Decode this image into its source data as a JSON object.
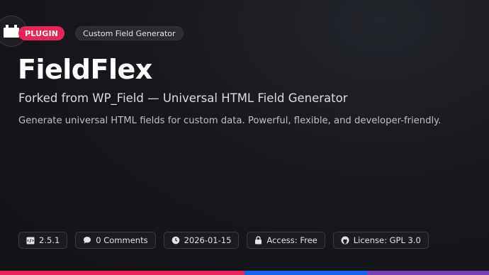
{
  "header": {
    "badge": "PLUGIN",
    "category": "Custom Field Generator"
  },
  "hero": {
    "title": "FieldFlex",
    "subtitle": "Forked from WP_Field — Universal HTML Field Generator",
    "description": "Generate universal HTML fields for custom data. Powerful, flexible, and developer-friendly."
  },
  "meta": {
    "version": "2.5.1",
    "comments": "0 Comments",
    "date": "2026-01-15",
    "access": "Access: Free",
    "license": "License: GPL 3.0"
  },
  "icons": {
    "corner": "plugin-icon",
    "version": "code-icon",
    "comments": "comment-bubble-icon",
    "date": "clock-icon",
    "access": "lock-icon",
    "license": "github-icon"
  },
  "colors": {
    "accent": "#e8245a",
    "bar": [
      "#e8245a",
      "#e8245a",
      "#1565e8",
      "#7b3fb8"
    ]
  }
}
